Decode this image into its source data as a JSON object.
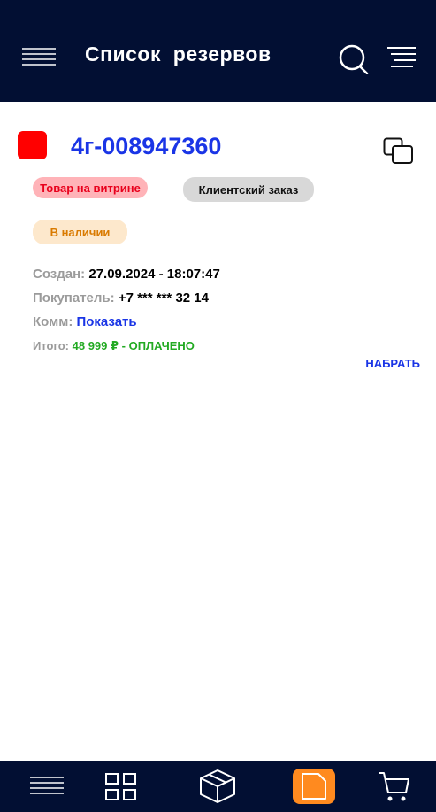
{
  "header": {
    "title": "Список  резервов",
    "menu_icon": "hamburger-icon",
    "search_icon": "search-icon",
    "filter_icon": "filter-icon"
  },
  "order": {
    "number": "4г-008947360",
    "status_color": "#ff0000",
    "badges": {
      "showcase": "Товар на витрине",
      "client_order": "Клиентский заказ",
      "in_stock": "В наличии"
    },
    "created_label": "Создан:",
    "created_value": "27.09.2024 - 18:07:47",
    "buyer_label": "Покупатель:",
    "buyer_value": "+7 *** *** 32 14",
    "comment_label": "Комм:",
    "comment_link": "Показать",
    "total_label": "Итого:",
    "total_value": "48 999 ₽ - ОПЛАЧЕНО",
    "dial_label": "НАБРАТЬ"
  },
  "bottom_nav": {
    "items": [
      "menu-icon",
      "grid-icon",
      "box-icon",
      "document-icon",
      "cart-icon"
    ],
    "active": "document-icon",
    "active_color": "#ff8a1f"
  }
}
